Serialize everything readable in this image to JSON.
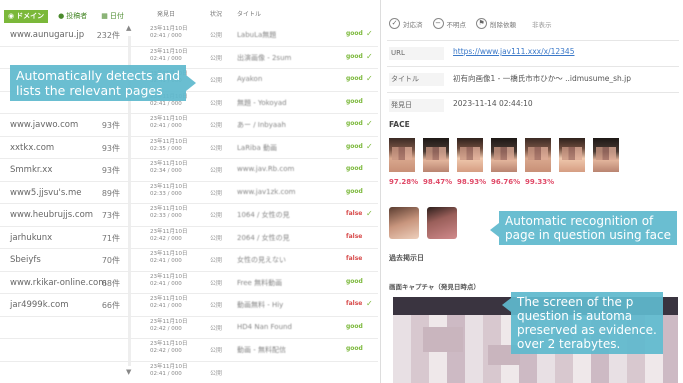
{
  "tabs": [
    {
      "label": "ドメイン",
      "icon": "globe-icon",
      "active": true
    },
    {
      "label": "投稿者",
      "icon": "person-icon",
      "active": false
    },
    {
      "label": "日付",
      "icon": "calendar-icon",
      "active": false
    }
  ],
  "columns": {
    "count": "",
    "date": "発見日",
    "tag": "状況",
    "title": "タイトル"
  },
  "rows": [
    {
      "domain": "www.aunugaru.jp",
      "count": "232件",
      "date": "23年11月10日",
      "time": "02:41 / 000",
      "tag": "公開",
      "title": "LabuLa無題",
      "status": "good",
      "check": true
    },
    {
      "domain": "",
      "count": "",
      "date": "23年11月10日",
      "time": "02:41 / 000",
      "tag": "公開",
      "title": "出演画像 - 2sum",
      "status": "good",
      "check": true
    },
    {
      "domain": "",
      "count": "",
      "date": "23年11月10日",
      "time": "02:41 / 000",
      "tag": "公開",
      "title": "Ayakon",
      "status": "good",
      "check": true
    },
    {
      "domain": "",
      "count": "",
      "date": "23年11月10日",
      "time": "02:41 / 000",
      "tag": "公開",
      "title": "無題 - Yokoyad",
      "status": "good",
      "check": false
    },
    {
      "domain": "www.javwo.com",
      "count": "93件",
      "date": "23年11月10日",
      "time": "02:41 / 000",
      "tag": "公開",
      "title": "あー / Inbyaah",
      "status": "good",
      "check": true
    },
    {
      "domain": "xxtkx.com",
      "count": "93件",
      "date": "23年11月10日",
      "time": "02:35 / 000",
      "tag": "公開",
      "title": "LaRiba 動画",
      "status": "good",
      "check": true
    },
    {
      "domain": "Smmkr.xx",
      "count": "93件",
      "date": "23年11月10日",
      "time": "02:34 / 000",
      "tag": "公開",
      "title": "www.jav.Rb.com",
      "status": "good",
      "check": false
    },
    {
      "domain": "www5.jjsvu's.me",
      "count": "89件",
      "date": "23年11月10日",
      "time": "02:33 / 000",
      "tag": "公開",
      "title": "www.jav1zk.com",
      "status": "good",
      "check": false
    },
    {
      "domain": "www.heubrujjs.com",
      "count": "73件",
      "date": "23年11月10日",
      "time": "02:33 / 000",
      "tag": "公開",
      "title": "1064 / 女性の見",
      "status": "false",
      "check": true
    },
    {
      "domain": "jarhukunx",
      "count": "71件",
      "date": "23年11月10日",
      "time": "02:42 / 000",
      "tag": "公開",
      "title": "2064 / 女性の見",
      "status": "false",
      "check": false
    },
    {
      "domain": "Sbeiyfs",
      "count": "70件",
      "date": "23年11月10日",
      "time": "02:41 / 000",
      "tag": "公開",
      "title": "女性の見えない",
      "status": "false",
      "check": false
    },
    {
      "domain": "www.rkikar-online.com",
      "count": "68件",
      "date": "23年11月10日",
      "time": "02:41 / 000",
      "tag": "公開",
      "title": "Free 無料動画",
      "status": "good",
      "check": false
    },
    {
      "domain": "jar4999k.com",
      "count": "66件",
      "date": "23年11月10日",
      "time": "02:41 / 000",
      "tag": "公開",
      "title": "動画無料 - Hiy",
      "status": "false",
      "check": true
    },
    {
      "domain": "",
      "count": "",
      "date": "23年11月10日",
      "time": "02:42 / 000",
      "tag": "公開",
      "title": "HD4 Nan Found",
      "status": "good",
      "check": false
    },
    {
      "domain": "",
      "count": "",
      "date": "23年11月10日",
      "time": "02:42 / 000",
      "tag": "公開",
      "title": "動画 - 無料配信",
      "status": "good",
      "check": false
    },
    {
      "domain": "",
      "count": "",
      "date": "23年11月10日",
      "time": "02:41 / 000",
      "tag": "公開",
      "title": "",
      "status": "",
      "check": false
    }
  ],
  "callout_left": [
    "Automatically detects and",
    "lists the relevant pages"
  ],
  "actions": [
    {
      "icon": "check-circle-icon",
      "label": "対応済"
    },
    {
      "icon": "minus-circle-icon",
      "label": "不明点"
    },
    {
      "icon": "flag-circle-icon",
      "label": "削除依頼"
    },
    {
      "icon": "",
      "label": "非表示"
    }
  ],
  "fields": [
    {
      "key": "URL",
      "value": "https://www.jav111.xxx/x/12345",
      "link": true
    },
    {
      "key": "タイトル",
      "value": "初有向画像1 - 一橋氏市市ひか〜 ..idmusume_sh.jp",
      "link": false
    },
    {
      "key": "発見日",
      "value": "2023-11-14 02:44:10",
      "link": false
    }
  ],
  "face_title": "FACE",
  "face_percents": [
    "97.28%",
    "98.47%",
    "98.93%",
    "96.76%",
    "99.33%"
  ],
  "callout_face": [
    "Automatic recognition of",
    "page in question using face"
  ],
  "past_title": "過去掲示日",
  "capture_title": "画面キャプチャ（発見日時点）",
  "callout_screen": [
    "The screen of the p",
    "question is automa",
    "preserved as evidence.",
    "over 2 terabytes."
  ]
}
